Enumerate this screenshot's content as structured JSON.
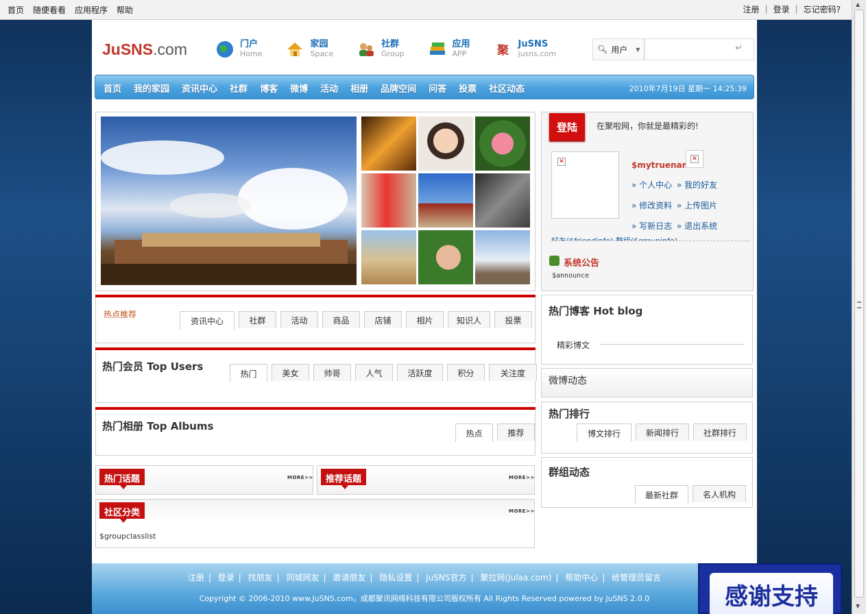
{
  "topbar": {
    "left": [
      "首页",
      "随便看看",
      "应用程序",
      "帮助"
    ],
    "right": [
      "注册",
      "登录",
      "忘记密码?"
    ],
    "sep": "|"
  },
  "logo": {
    "brand": "JuSNS",
    "suffix": ".com"
  },
  "nav_icons": [
    {
      "t1": "门户",
      "t2": "Home"
    },
    {
      "t1": "家园",
      "t2": "Space"
    },
    {
      "t1": "社群",
      "t2": "Group"
    },
    {
      "t1": "应用",
      "t2": "APP"
    },
    {
      "t1": "JuSNS",
      "t2": "jusns.com",
      "badge": "聚"
    }
  ],
  "search": {
    "select": "用户",
    "value": "",
    "enter": "↵"
  },
  "mainnav": {
    "items": [
      "首页",
      "我的家园",
      "资讯中心",
      "社群",
      "博客",
      "微博",
      "活动",
      "相册",
      "品牌空间",
      "问答",
      "投票",
      "社区动态"
    ],
    "datetime": "2010年7月19日 星期一 14:25:39"
  },
  "hot": {
    "title": "热点推荐",
    "tabs": [
      "资讯中心",
      "社群",
      "活动",
      "商品",
      "店铺",
      "相片",
      "知识人",
      "投票"
    ]
  },
  "users": {
    "title": "热门会员 Top Users",
    "tabs": [
      "热门",
      "美女",
      "帅哥",
      "人气",
      "活跃度",
      "积分",
      "关注度"
    ]
  },
  "albums": {
    "title": "热门相册 Top Albums",
    "tabs": [
      "热点",
      "推荐"
    ]
  },
  "topics": {
    "hot": "热门话题",
    "rec": "推荐话题",
    "more": "MORE>>"
  },
  "community": {
    "title": "社区分类",
    "content": "$groupclasslist",
    "more": "MORE>>"
  },
  "login": {
    "button": "登陆",
    "welcome": "在聚啦网，你就是最精彩的!",
    "name": "$mytruename",
    "links": [
      "个人中心",
      "我的好友",
      "修改资料",
      "上传图片",
      "写新日志",
      "退出系统"
    ],
    "bottom": "好友($friendinfo)  群组($groupinfo)",
    "notice_title": "系统公告",
    "notice": "$announce"
  },
  "blog": {
    "title": "热门博客 Hot blog",
    "sub": "精彩博文"
  },
  "weibo": {
    "title": "微博动态"
  },
  "rank": {
    "title": "热门排行",
    "tabs": [
      "博文排行",
      "新闻排行",
      "社群排行"
    ]
  },
  "group": {
    "title": "群组动态",
    "tabs": [
      "最新社群",
      "名人机构"
    ]
  },
  "footer": {
    "links": [
      "注册",
      "登录",
      "找朋友",
      "同城网友",
      "邀请朋友",
      "隐私设置",
      "JuSNS官方",
      "聚拉网(Julaa.com)",
      "帮助中心",
      "给管理员留言"
    ],
    "copy": "Copyright © 2006-2010 www.JuSNS.com，成都聚讯网络科技有限公司版权所有 All Rights Reserved powered by  JuSNS   2.0.0"
  },
  "thanks": "感谢支持"
}
